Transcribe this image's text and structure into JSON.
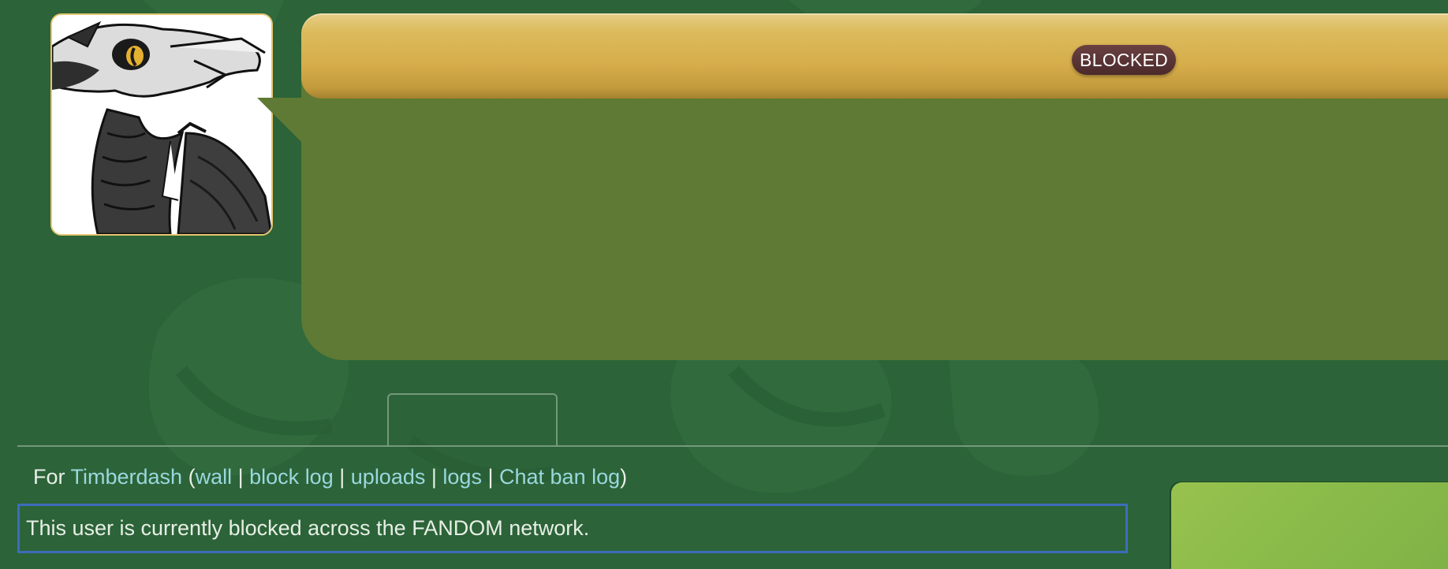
{
  "profile": {
    "status_tag": "BLOCKED"
  },
  "contribs": {
    "prefix": "For",
    "username": "Timberdash",
    "open_paren": "(",
    "links": [
      "wall",
      "block log",
      "uploads",
      "logs",
      "Chat ban log"
    ],
    "separator": "|",
    "close_paren": ")"
  },
  "notice": {
    "text": "This user is currently blocked across the FANDOM network."
  },
  "colors": {
    "page_bg": "#2c6338",
    "masthead_bg": "#5e7a34",
    "masthead_bar": "#d6ad4a",
    "link": "#9ad8df",
    "tag_bg": "#4a2a2c",
    "notice_border": "#3d6dbb",
    "rail_bg": "#8cbc4a"
  },
  "icons": {
    "avatar": "dragon-avatar-icon"
  }
}
